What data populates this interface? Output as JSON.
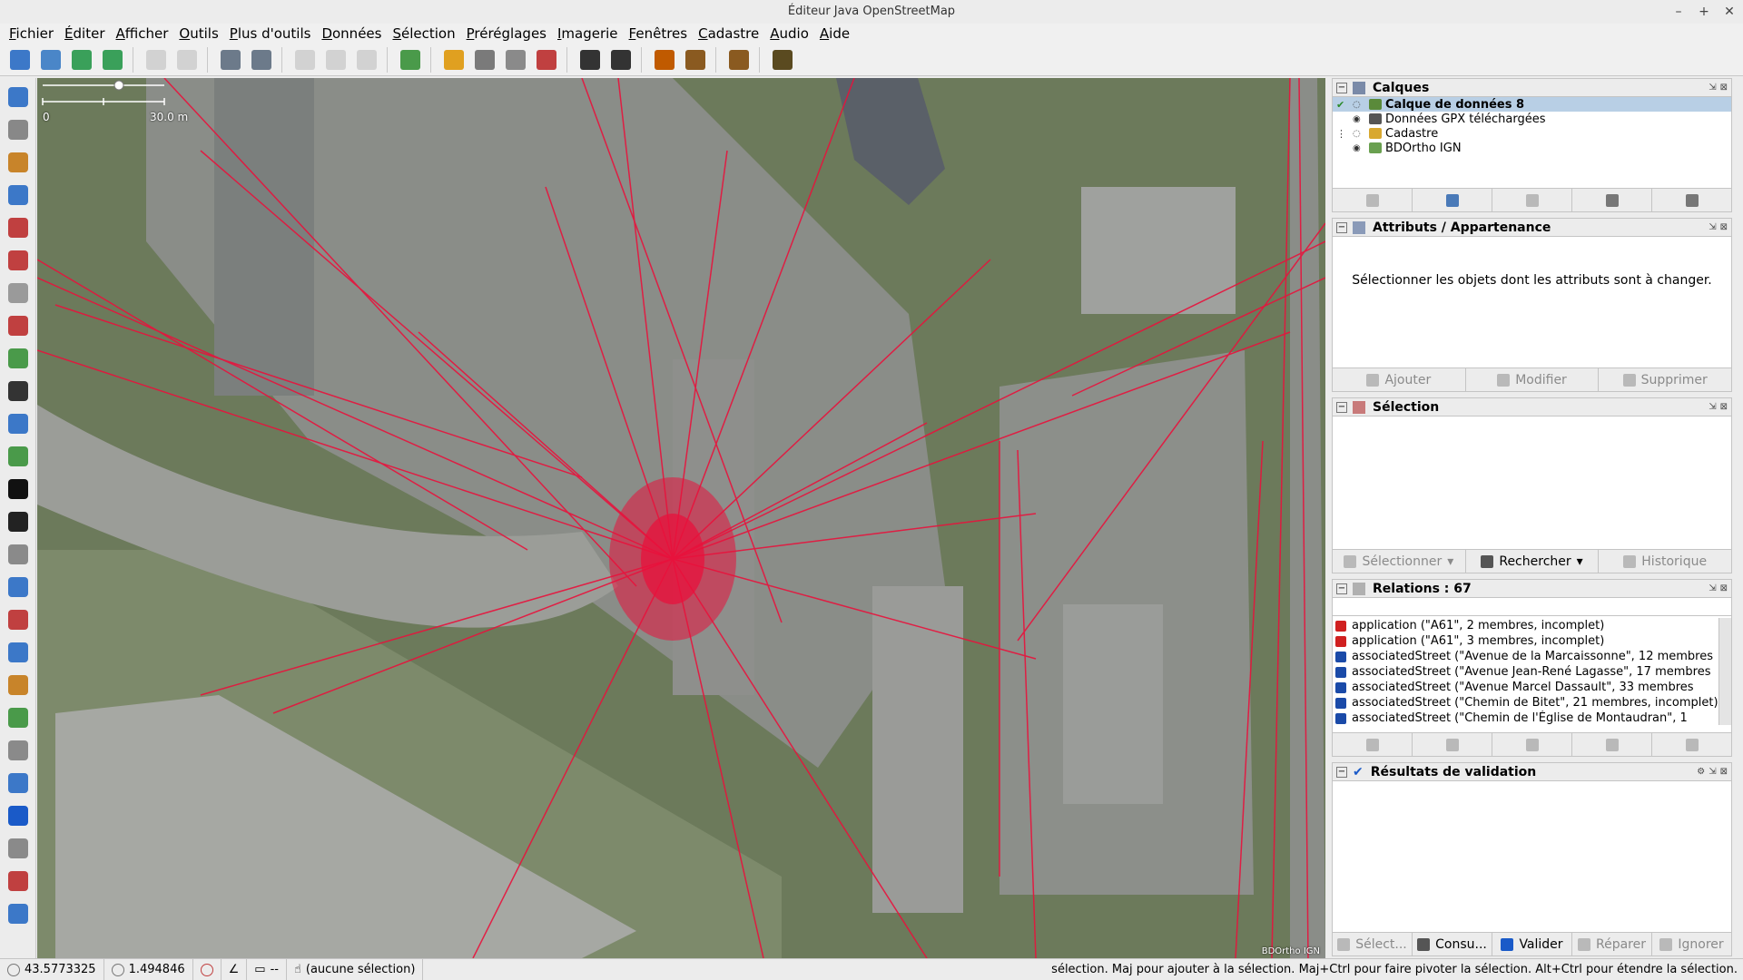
{
  "window": {
    "title": "Éditeur Java OpenStreetMap",
    "controls": [
      "–",
      "+",
      "✕"
    ]
  },
  "menu": [
    "Fichier",
    "Éditer",
    "Afficher",
    "Outils",
    "Plus d'outils",
    "Données",
    "Sélection",
    "Préréglages",
    "Imagerie",
    "Fenêtres",
    "Cadastre",
    "Audio",
    "Aide"
  ],
  "toolbar": {
    "icons": [
      {
        "name": "open-file-icon",
        "color": "#3c78c8"
      },
      {
        "name": "save-icon",
        "color": "#4a86c8"
      },
      {
        "name": "download-icon",
        "color": "#3aa05a"
      },
      {
        "name": "upload-icon",
        "color": "#3aa05a"
      },
      {
        "name": "undo-icon",
        "color": "#9a9a9a"
      },
      {
        "name": "redo-icon",
        "color": "#9a9a9a"
      },
      {
        "name": "preferences-icon",
        "color": "#6c7a8a"
      },
      {
        "name": "layer-properties-icon",
        "color": "#6c7a8a"
      },
      {
        "name": "split-way-icon",
        "color": "#9a9a9a"
      },
      {
        "name": "combine-way-icon",
        "color": "#9a9a9a"
      },
      {
        "name": "refresh-icon",
        "color": "#9a9a9a"
      },
      {
        "name": "validator-icon",
        "color": "#4a9a4a"
      },
      {
        "name": "road-preset-icon",
        "color": "#e0a020"
      },
      {
        "name": "highway-preset-icon",
        "color": "#7a7a7a"
      },
      {
        "name": "traffic-light-icon",
        "color": "#8a8a8a"
      },
      {
        "name": "building-preset-icon",
        "color": "#c04040"
      },
      {
        "name": "car-icon",
        "color": "#333333"
      },
      {
        "name": "bus-icon",
        "color": "#333333"
      },
      {
        "name": "warning-icon",
        "color": "#c05a00"
      },
      {
        "name": "restaurant-icon",
        "color": "#8a5a20"
      },
      {
        "name": "castle-icon",
        "color": "#8a5a20"
      },
      {
        "name": "industrial-icon",
        "color": "#5a4a20"
      }
    ]
  },
  "left_tools": [
    {
      "name": "select-tool-icon",
      "color": "#3c78c8"
    },
    {
      "name": "lasso-tool-icon",
      "color": "#888888"
    },
    {
      "name": "draw-tool-icon",
      "color": "#c8842a"
    },
    {
      "name": "zoom-tool-icon",
      "color": "#3c78c8"
    },
    {
      "name": "delete-tool-icon",
      "color": "#c04040"
    },
    {
      "name": "parallel-tool-icon",
      "color": "#c04040"
    },
    {
      "name": "improve-way-icon",
      "color": "#9a9a9a"
    },
    {
      "name": "extrude-tool-icon",
      "color": "#c04040"
    },
    {
      "name": "align-tool-icon",
      "color": "#4a9a4a"
    },
    {
      "name": "building-tool-icon",
      "color": "#333333"
    },
    {
      "name": "circle-tool-icon",
      "color": "#3c78c8"
    },
    {
      "name": "area-tool-icon",
      "color": "#4a9a4a"
    },
    {
      "name": "bw-toggle-icon",
      "color": "#111111"
    },
    {
      "name": "more-tools-icon",
      "color": "#222222"
    },
    {
      "name": "layer-list-icon",
      "color": "#8a8a8a"
    },
    {
      "name": "tag-tool-icon",
      "color": "#3c78c8"
    },
    {
      "name": "relation-tool-icon",
      "color": "#c04040"
    },
    {
      "name": "selection-list-icon",
      "color": "#3c78c8"
    },
    {
      "name": "edit-properties-icon",
      "color": "#c8842a"
    },
    {
      "name": "history-icon",
      "color": "#4a9a4a"
    },
    {
      "name": "map-paint-icon",
      "color": "#8a8a8a"
    },
    {
      "name": "audio-icon",
      "color": "#3c78c8"
    },
    {
      "name": "validate-icon",
      "color": "#1a5ac8"
    },
    {
      "name": "filter-icon",
      "color": "#8a8a8a"
    },
    {
      "name": "notes-icon",
      "color": "#c04040"
    },
    {
      "name": "changesets-icon",
      "color": "#3c78c8"
    }
  ],
  "map": {
    "scale_label_start": "0",
    "scale_label_end": "30.0 m",
    "attribution": "BDOrtho IGN"
  },
  "layers_panel": {
    "title": "Calques",
    "items": [
      {
        "label": "Calque de données 8",
        "selected": true,
        "color": "#5a8a3a"
      },
      {
        "label": "Données GPX téléchargées",
        "selected": false,
        "color": "#555555"
      },
      {
        "label": "Cadastre",
        "selected": false,
        "color": "#d8a830"
      },
      {
        "label": "BDOrtho IGN",
        "selected": false,
        "color": "#6aa050"
      }
    ]
  },
  "attributes_panel": {
    "title": "Attributs / Appartenance",
    "message": "Sélectionner les objets dont les attributs sont à changer.",
    "buttons": [
      "Ajouter",
      "Modifier",
      "Supprimer"
    ]
  },
  "selection_panel": {
    "title": "Sélection",
    "buttons": [
      "Sélectionner",
      "Rechercher",
      "Historique"
    ]
  },
  "relations_panel": {
    "title": "Relations : 67",
    "items": [
      {
        "label": "application (\"A61\", 2 membres, incomplet)",
        "color": "#d02020"
      },
      {
        "label": "application (\"A61\", 3 membres, incomplet)",
        "color": "#d02020"
      },
      {
        "label": "associatedStreet (\"Avenue de la Marcaissonne\", 12 membres",
        "color": "#1a4aa8"
      },
      {
        "label": "associatedStreet (\"Avenue Jean-René Lagasse\", 17 membres",
        "color": "#1a4aa8"
      },
      {
        "label": "associatedStreet (\"Avenue Marcel Dassault\", 33 membres",
        "color": "#1a4aa8"
      },
      {
        "label": "associatedStreet (\"Chemin de Bitet\", 21 membres, incomplet)",
        "color": "#1a4aa8"
      },
      {
        "label": "associatedStreet (\"Chemin de l'Église de Montaudran\", 1",
        "color": "#1a4aa8"
      }
    ]
  },
  "validation_panel": {
    "title": "Résultats de validation",
    "buttons": [
      "Sélect...",
      "Consu...",
      "Valider",
      "Réparer",
      "Ignorer"
    ]
  },
  "status": {
    "lat": "43.5773325",
    "lon": "1.494846",
    "selection": "(aucune sélection)",
    "dist": "--",
    "help": "sélection. Maj pour ajouter à la sélection. Maj+Ctrl pour faire pivoter la sélection. Alt+Ctrl pour étendre la sélection."
  }
}
